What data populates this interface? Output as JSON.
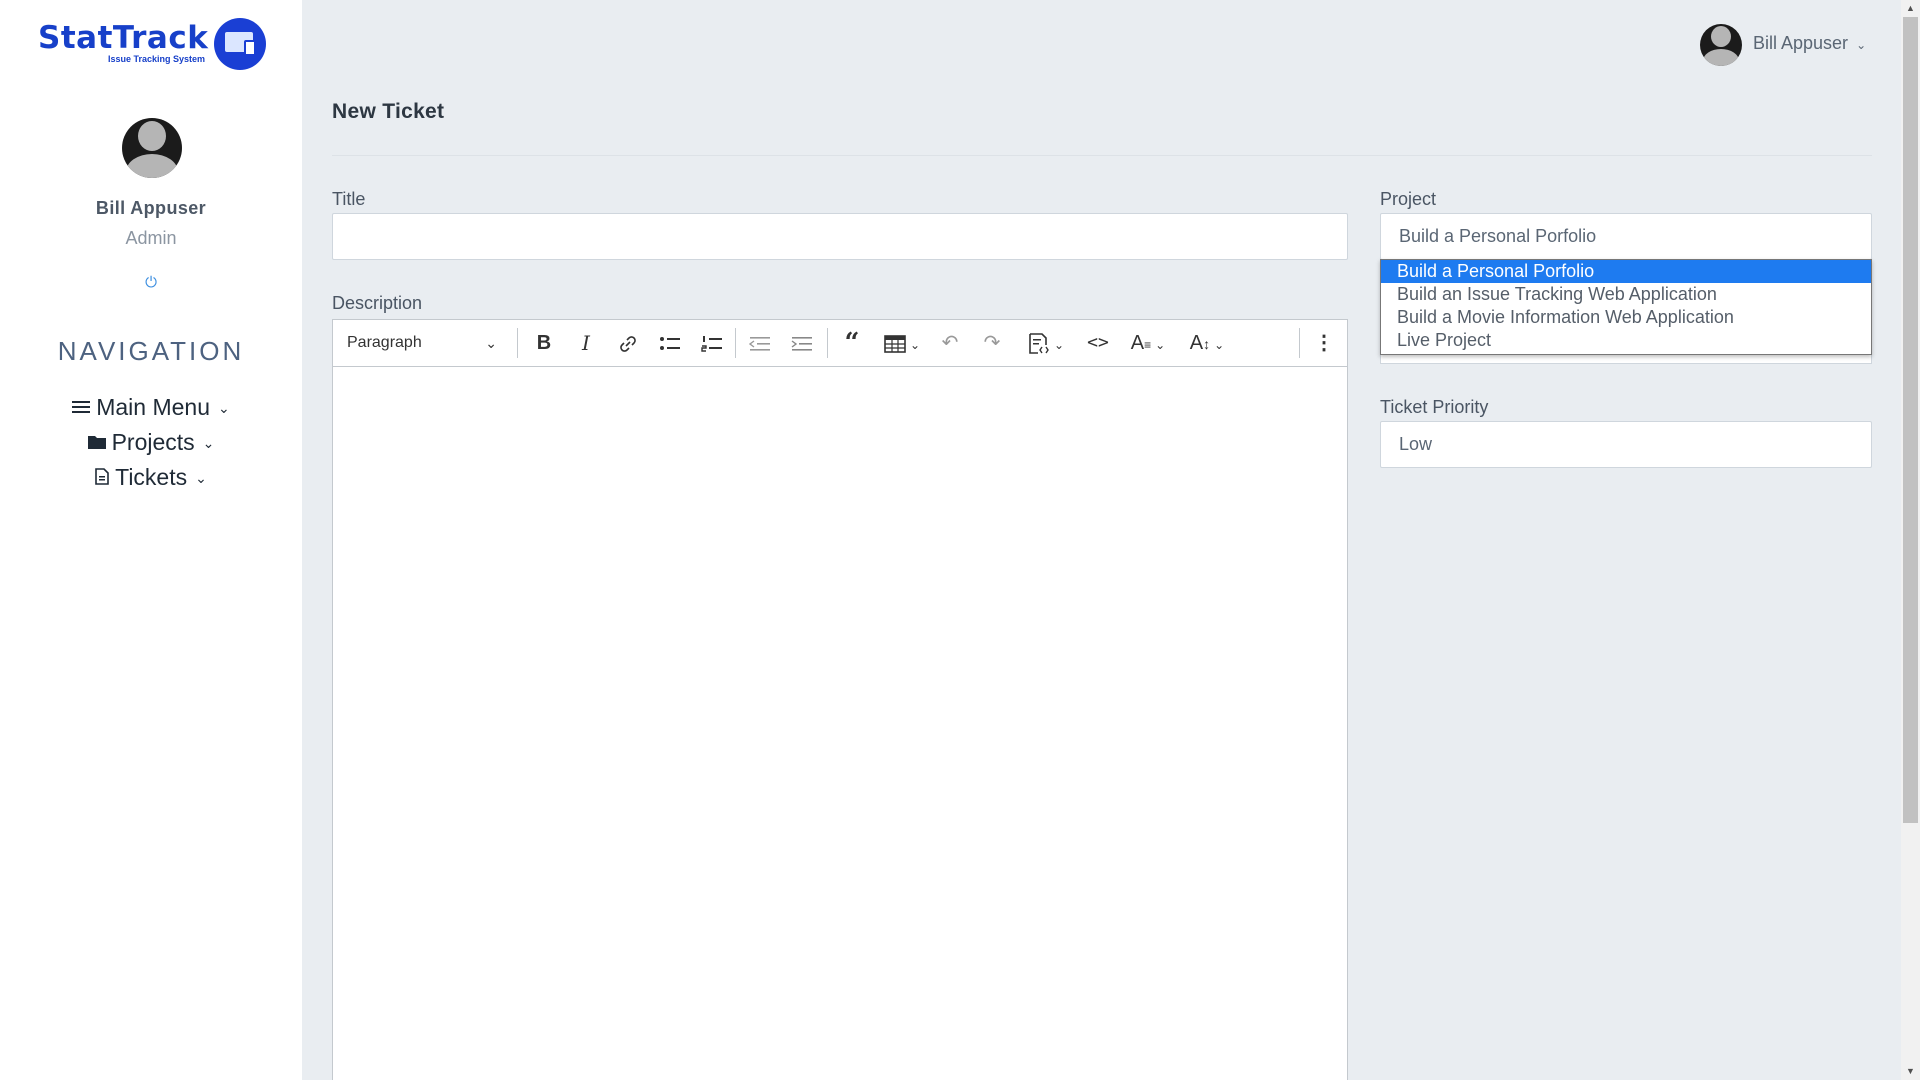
{
  "brand": {
    "name": "StatTrack",
    "tagline": "Issue Tracking System"
  },
  "sidebar": {
    "user_name": "Bill Appuser",
    "user_role": "Admin",
    "power_icon": "⏻",
    "nav_title": "NAVIGATION",
    "items": [
      {
        "label": "Main Menu",
        "icon": "menu-icon"
      },
      {
        "label": "Projects",
        "icon": "folder-icon"
      },
      {
        "label": "Tickets",
        "icon": "file-icon"
      }
    ]
  },
  "header": {
    "user_name": "Bill Appuser"
  },
  "main": {
    "page_title": "New Ticket",
    "title_label": "Title",
    "title_value": "",
    "description_label": "Description",
    "editor": {
      "block_format": "Paragraph",
      "tools": [
        "bold",
        "italic",
        "link",
        "bulleted-list",
        "numbered-list",
        "outdent",
        "indent",
        "block-quote",
        "insert-table",
        "undo",
        "redo",
        "source-editing",
        "code",
        "font-family",
        "font-size",
        "more"
      ]
    },
    "project_label": "Project",
    "project_value": "Build a Personal Porfolio",
    "project_options": [
      "Build a Personal Porfolio",
      "Build an Issue Tracking Web Application",
      "Build a Movie Information Web Application",
      "Live Project"
    ],
    "project_selected_index": 0,
    "priority_label": "Ticket Priority",
    "priority_value": "Low"
  },
  "colors": {
    "brand_blue": "#1740c9",
    "selected_option": "#1e7bf0",
    "page_background": "#e9edf1"
  }
}
